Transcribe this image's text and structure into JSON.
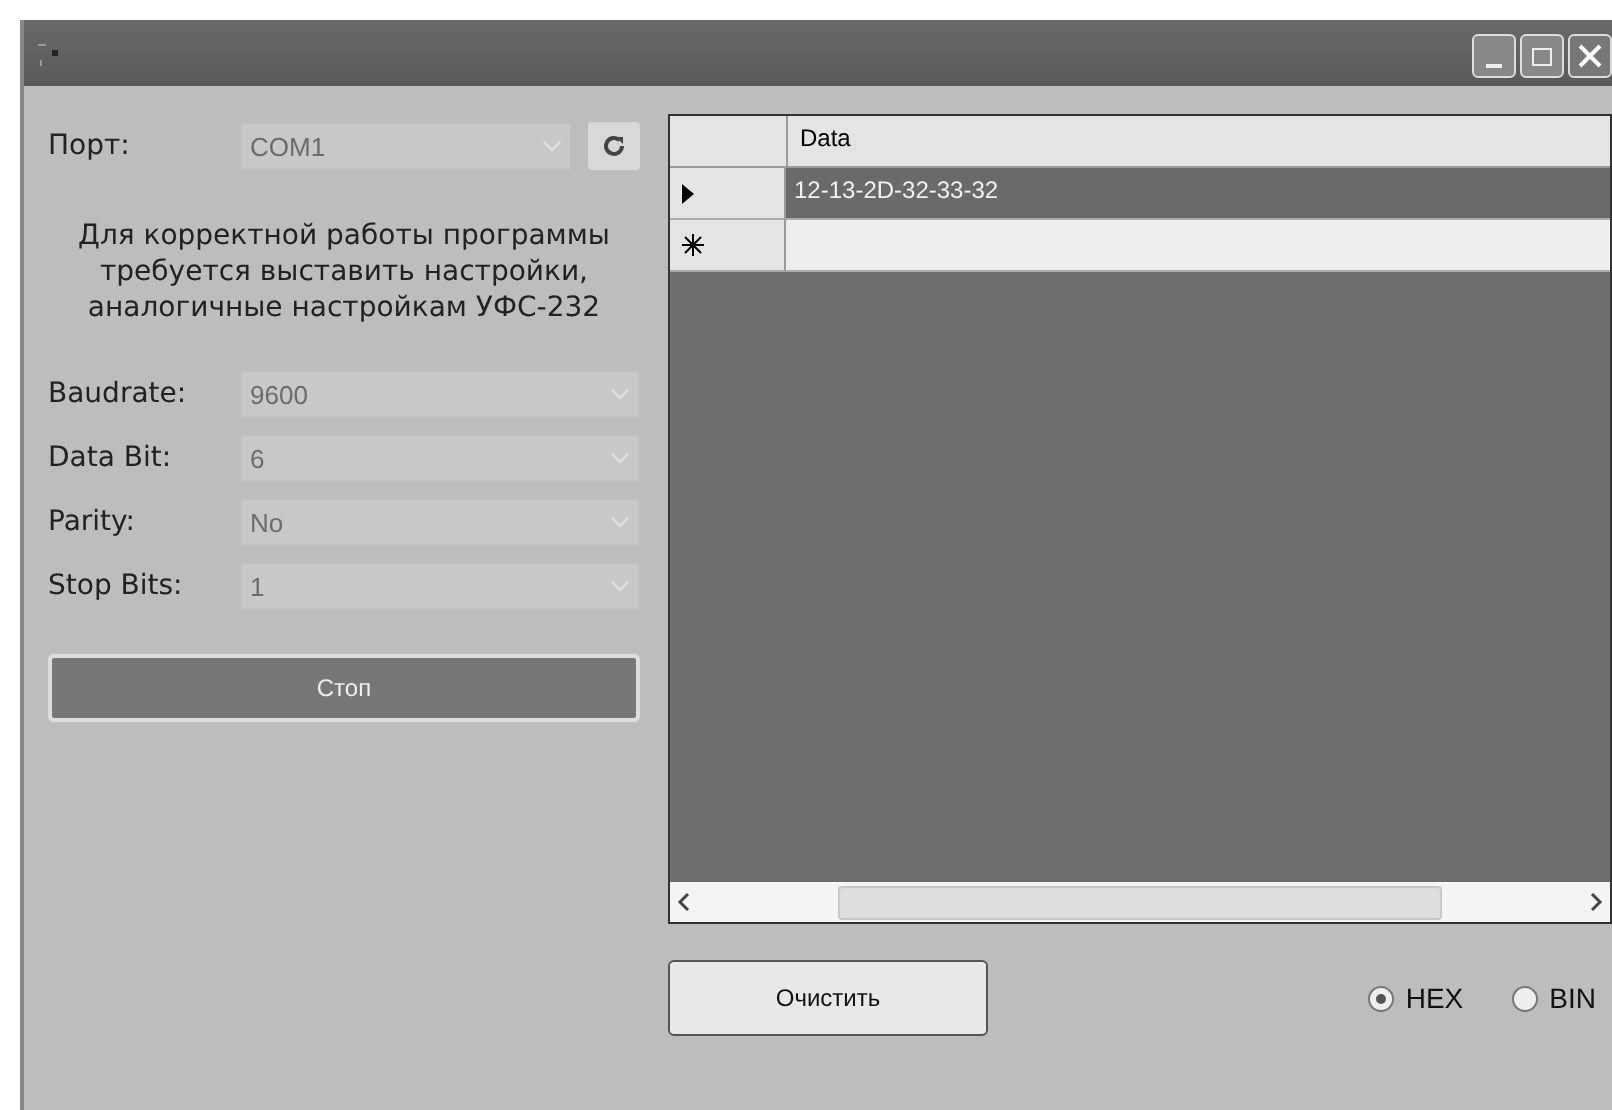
{
  "window": {
    "controls": [
      {
        "kind": "minimize"
      },
      {
        "kind": "maximize"
      },
      {
        "kind": "close"
      }
    ]
  },
  "port": {
    "label": "Порт:",
    "value": "COM1",
    "disabled": true
  },
  "hint": "Для корректной работы программы требуется выставить настройки, аналогичные настройкам УФС-232",
  "settings": [
    {
      "label": "Baudrate:",
      "value": "9600",
      "disabled": true
    },
    {
      "label": "Data Bit:",
      "value": "6",
      "disabled": true
    },
    {
      "label": "Parity:",
      "value": "No",
      "disabled": true
    },
    {
      "label": "Stop Bits:",
      "value": "1",
      "disabled": true
    }
  ],
  "stop_button": "Стоп",
  "table": {
    "columns": [
      "Data"
    ],
    "rows": [
      {
        "kind": "current",
        "value": "12-13-2D-32-33-32",
        "selected": true
      },
      {
        "kind": "new",
        "selected": false
      }
    ]
  },
  "clear_button": "Очистить",
  "format": [
    {
      "label": "HEX",
      "selected": true
    },
    {
      "label": "BIN",
      "selected": false
    }
  ]
}
